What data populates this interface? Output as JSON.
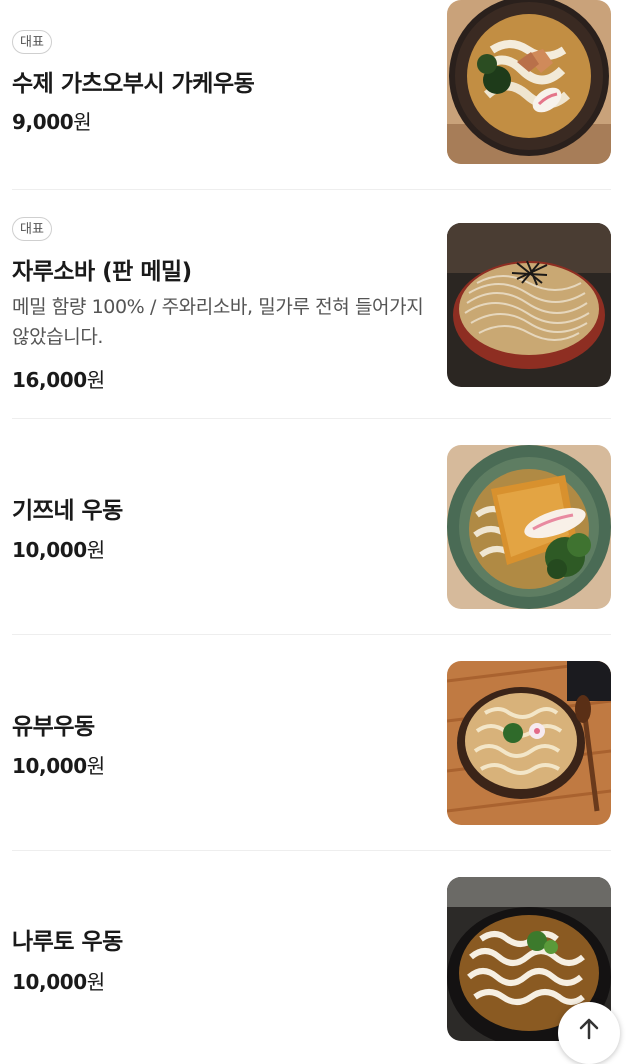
{
  "menu": {
    "items": [
      {
        "badge": "대표",
        "name": "수제 가츠오부시 가케우동",
        "description": "",
        "price": "9,000",
        "currency": "원",
        "image": "udon-with-bonito-flakes"
      },
      {
        "badge": "대표",
        "name": "자루소바 (판 메밀)",
        "description": "메밀 함량 100% / 주와리소바, 밀가루 전혀 들어가지 않았습니다.",
        "price": "16,000",
        "currency": "원",
        "image": "zaru-soba"
      },
      {
        "badge": "",
        "name": "기쯔네 우동",
        "description": "",
        "price": "10,000",
        "currency": "원",
        "image": "kitsune-udon"
      },
      {
        "badge": "",
        "name": "유부우동",
        "description": "",
        "price": "10,000",
        "currency": "원",
        "image": "yubu-udon"
      },
      {
        "badge": "",
        "name": "나루토 우동",
        "description": "",
        "price": "10,000",
        "currency": "원",
        "image": "naruto-udon"
      }
    ]
  },
  "scroll_top": {
    "icon": "arrow-up-icon"
  }
}
